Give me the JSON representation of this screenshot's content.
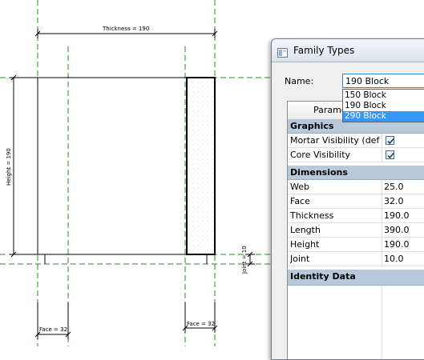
{
  "drawing": {
    "thickness_dim": "Thickness = 190",
    "height_dim": "Height = 190",
    "joint_dim": "Joint = 10",
    "face_dim_left": "Face = 32",
    "face_dim_right": "Face = 32"
  },
  "dialog": {
    "title": "Family Types",
    "name_label": "Name:",
    "selected_type": "190 Block",
    "dropdown_options": [
      "150 Block",
      "190 Block",
      "290 Block"
    ],
    "highlighted_option_index": 2,
    "parameter_header": "Parame",
    "groups": {
      "graphics": {
        "label": "Graphics",
        "rows": [
          {
            "name": "Mortar Visibility (defa",
            "checked": true
          },
          {
            "name": "Core Visibility",
            "checked": true
          }
        ]
      },
      "dimensions": {
        "label": "Dimensions",
        "rows": [
          {
            "name": "Web",
            "value": "25.0"
          },
          {
            "name": "Face",
            "value": "32.0"
          },
          {
            "name": "Thickness",
            "value": "190.0"
          },
          {
            "name": "Length",
            "value": "390.0"
          },
          {
            "name": "Height",
            "value": "190.0"
          },
          {
            "name": "Joint",
            "value": "10.0"
          }
        ]
      },
      "identity": {
        "label": "Identity Data"
      }
    }
  },
  "colors": {
    "reference_plane": "#2a8a2a",
    "selection": "#3399ff",
    "group_header": "#b9c9dc"
  }
}
